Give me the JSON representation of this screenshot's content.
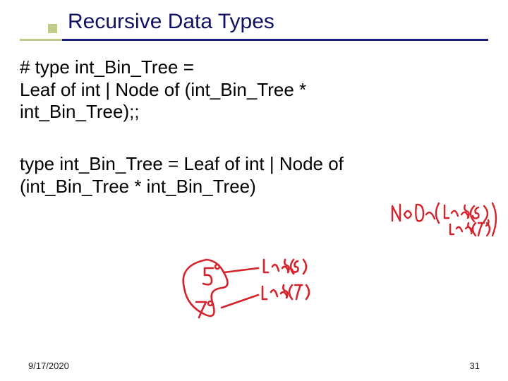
{
  "title": "Recursive Data Types",
  "code": {
    "line1": "# type int_Bin_Tree =",
    "line2": " Leaf of int | Node of (int_Bin_Tree *",
    "line3": "   int_Bin_Tree);;"
  },
  "result": {
    "line1": "type int_Bin_Tree = Leaf of int | Node of",
    "line2": "   (int_Bin_Tree * int_Bin_Tree)"
  },
  "annotations": {
    "node_right": "Node (Leaf(5), Leaf(7))",
    "leaf5": "Leaf(5)",
    "leaf7": "Leaf(7)",
    "five": "5",
    "seven": "7"
  },
  "footer": {
    "date": "9/17/2020",
    "page": "31"
  }
}
